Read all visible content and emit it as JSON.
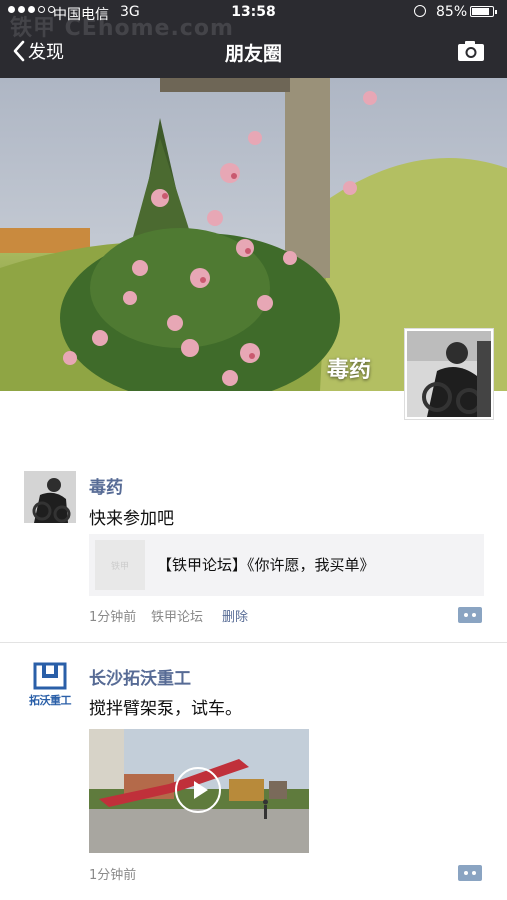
{
  "status_bar": {
    "carrier": "中国电信",
    "network": "3G",
    "time": "13:58",
    "battery": "85%",
    "battery_level": 0.85
  },
  "watermark": "铁甲 CEhome.com",
  "nav": {
    "back_label": "发现",
    "title": "朋友圈",
    "camera_icon": "camera-icon"
  },
  "profile": {
    "name": "毒药"
  },
  "posts": [
    {
      "author": "毒药",
      "text": "快来参加吧",
      "share": {
        "thumb_text": "铁甲",
        "title": "【铁甲论坛】《你许愿，我买单》"
      },
      "time": "1分钟前",
      "source": "铁甲论坛",
      "delete_label": "删除"
    },
    {
      "author": "长沙拓沃重工",
      "logo_text": "拓沃重工",
      "text": "搅拌臂架泵，试车。",
      "time": "1分钟前"
    }
  ],
  "colors": {
    "nav_bg": "#2b2b30",
    "link": "#576b95",
    "meta": "#8a8a8a"
  }
}
